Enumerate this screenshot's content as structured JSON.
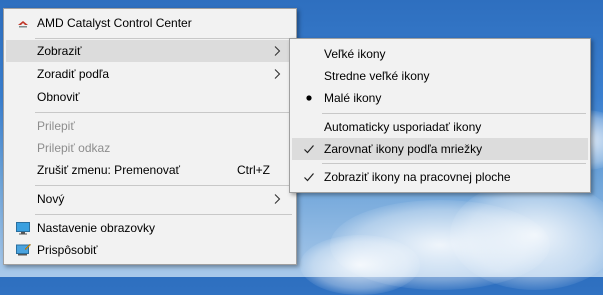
{
  "main_menu": {
    "amd": "AMD Catalyst Control Center",
    "view": "Zobraziť",
    "sort_by": "Zoradiť podľa",
    "refresh": "Obnoviť",
    "paste": "Prilepiť",
    "paste_shortcut": "Prilepiť odkaz",
    "undo": "Zrušiť zmenu: Premenovať",
    "undo_shortcut": "Ctrl+Z",
    "new": "Nový",
    "display_settings": "Nastavenie obrazovky",
    "personalize": "Prispôsobiť"
  },
  "view_submenu": {
    "large": "Veľké ikony",
    "medium": "Stredne veľké ikony",
    "small": "Malé ikony",
    "auto_arrange": "Automaticky usporiadať ikony",
    "align_grid": "Zarovnať ikony podľa mriežky",
    "show_icons": "Zobraziť ikony na pracovnej ploche"
  },
  "colors": {
    "menu_bg": "#f2f2f2",
    "highlight": "#dcdcdc",
    "disabled_text": "#8d8d8d"
  }
}
